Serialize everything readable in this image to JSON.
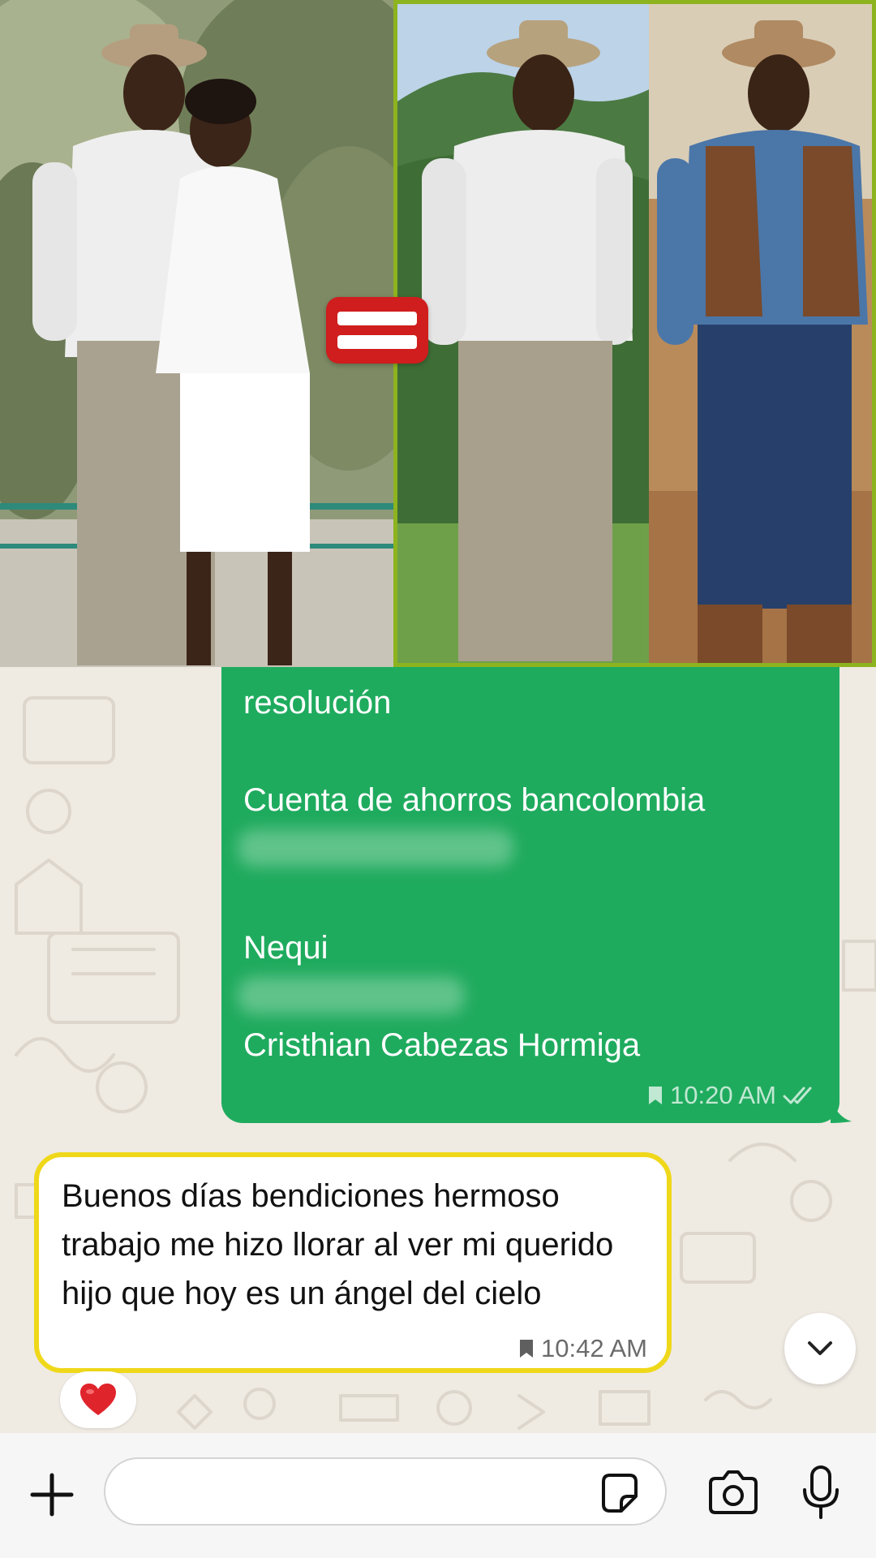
{
  "photo_banner": {
    "equals_symbol": "="
  },
  "outgoing_message": {
    "line_resolucion": "resolución",
    "line_bank": "Cuenta de ahorros bancolombia",
    "line_nequi": "Nequi",
    "line_name": "Cristhian Cabezas Hormiga",
    "time": "10:20 AM",
    "status_icon": "double-check-icon",
    "saved_icon": "bookmark-icon"
  },
  "incoming_message": {
    "text": "Buenos días bendiciones hermoso trabajo me hizo llorar al ver mi querido hijo que hoy es un ángel del cielo",
    "time": "10:42 AM",
    "saved_icon": "bookmark-icon",
    "reaction": "❤️"
  },
  "composer": {
    "input_value": "",
    "plus_icon": "plus-icon",
    "sticker_icon": "sticker-icon",
    "camera_icon": "camera-icon",
    "mic_icon": "microphone-icon"
  },
  "colors": {
    "outgoing_bubble": "#1fab5e",
    "incoming_highlight": "#efd81a",
    "photo_frame": "#8db31e",
    "equals_badge": "#d01d1d",
    "chat_background": "#efeae2"
  }
}
